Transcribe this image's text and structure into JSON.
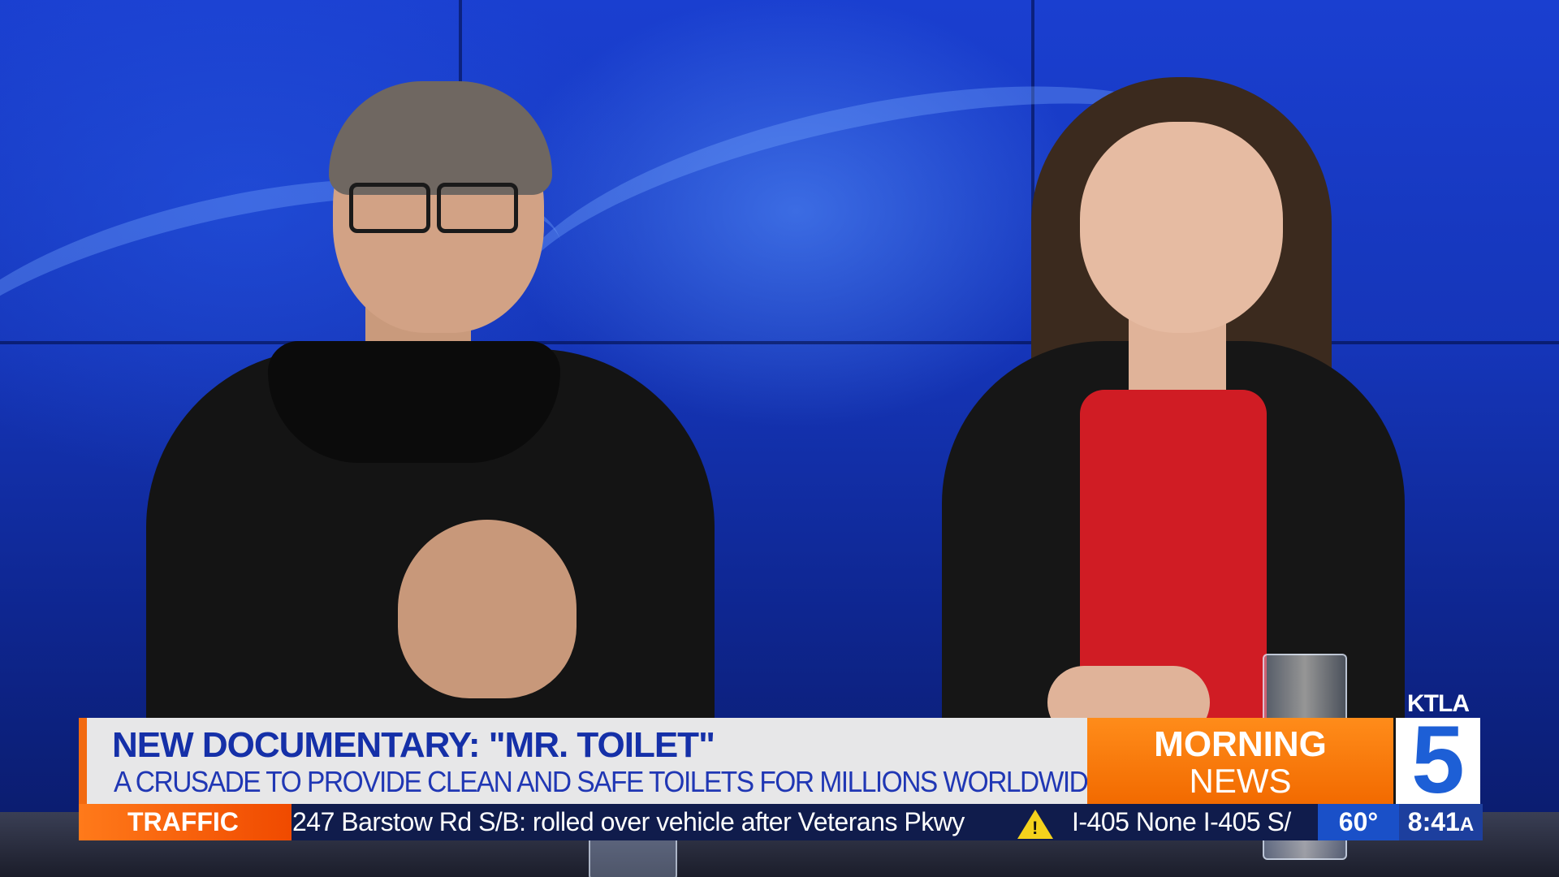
{
  "lower_third": {
    "headline": "NEW DOCUMENTARY: \"MR. TOILET\"",
    "subline": "A CRUSADE TO PROVIDE CLEAN AND SAFE TOILETS FOR MILLIONS WORLDWIDE"
  },
  "show": {
    "line1": "MORNING",
    "line2": "NEWS"
  },
  "logo": {
    "word": "KTLA",
    "number": "5"
  },
  "ticker": {
    "label": "TRAFFIC",
    "text": "247 Barstow Rd S/B: rolled over vehicle after Veterans Pkwy",
    "text2": "I-405 None I-405 S/",
    "temperature": "60°",
    "time": "8:41",
    "ampm": "A"
  },
  "colors": {
    "brand_blue": "#1530a8",
    "accent_orange": "#f26a10"
  }
}
